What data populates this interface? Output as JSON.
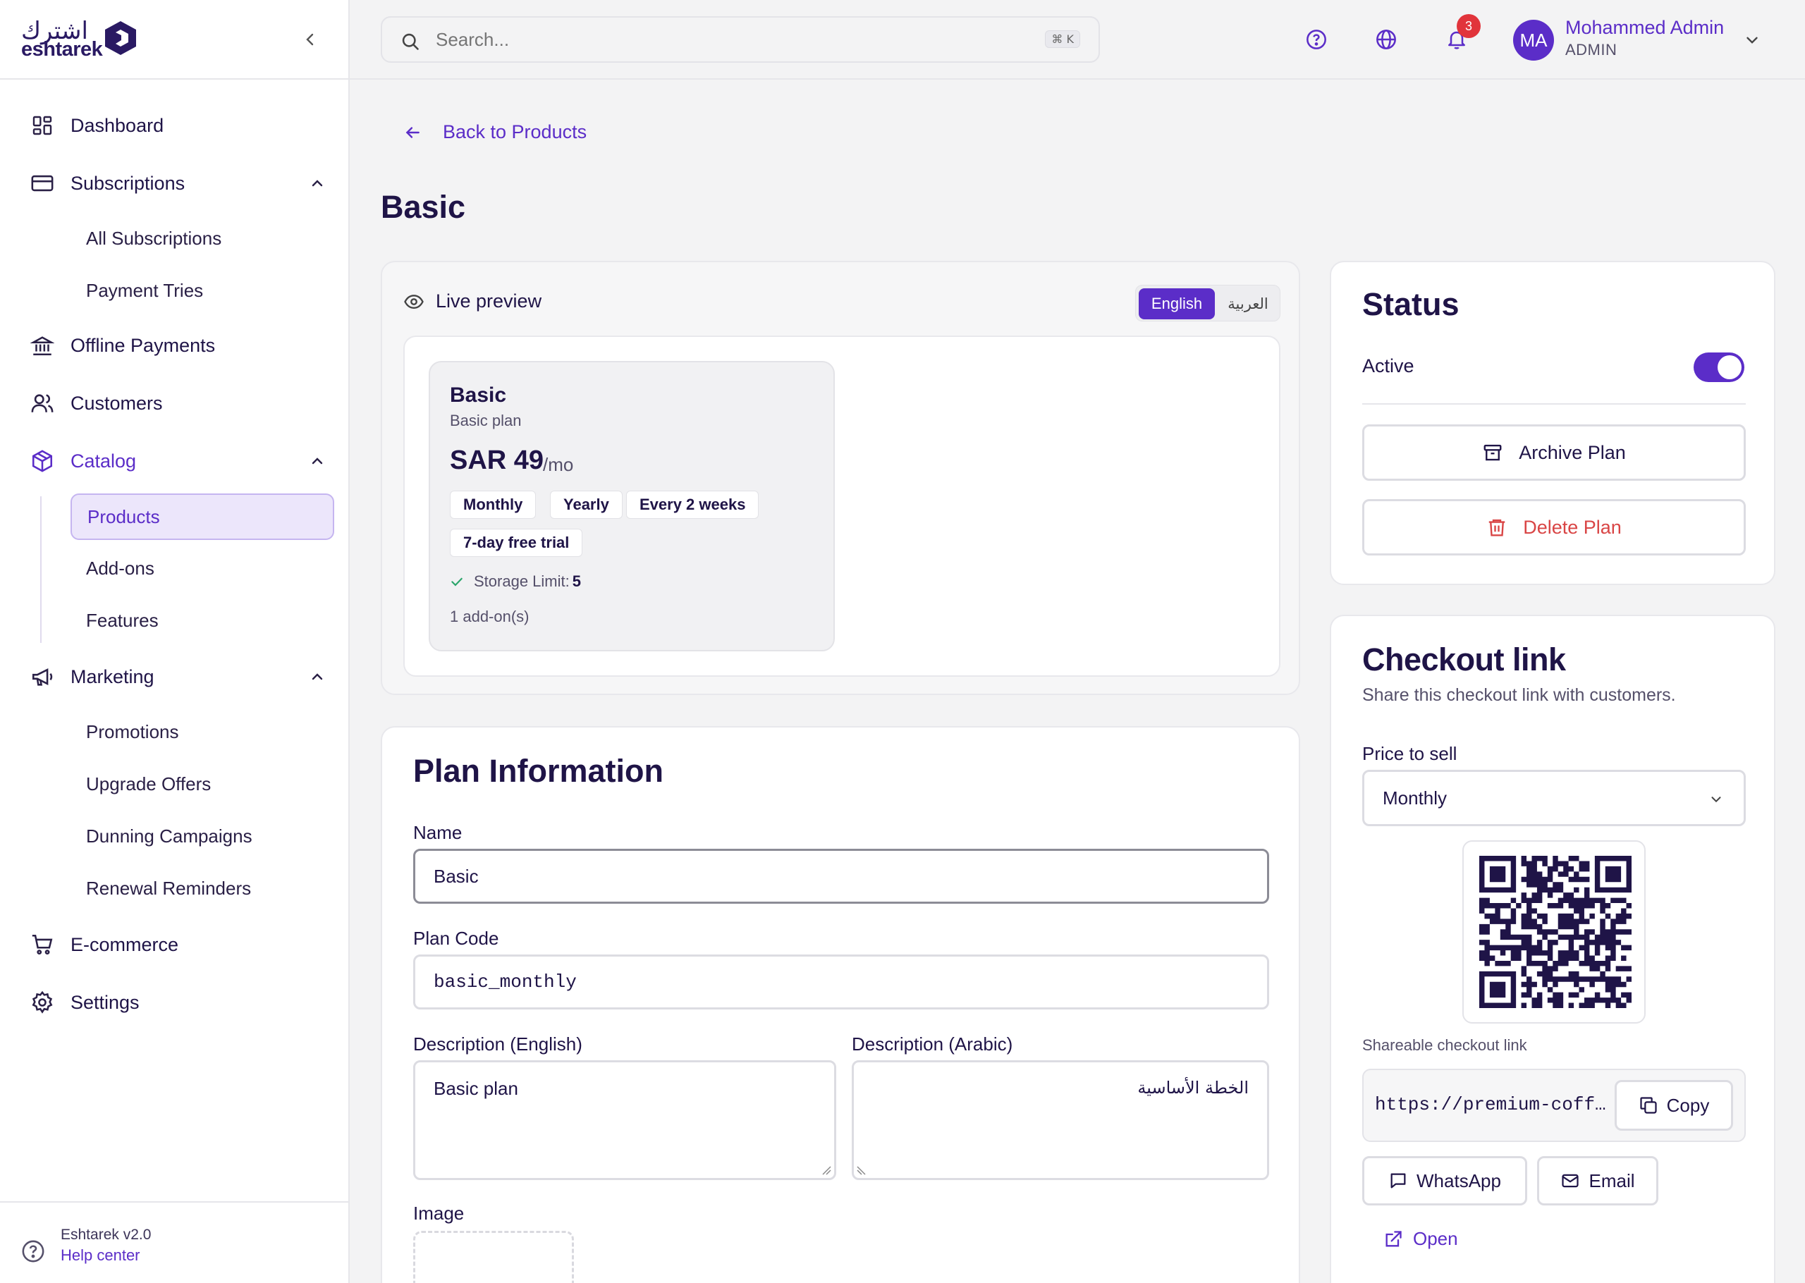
{
  "brand": {
    "arabic": "اشترك",
    "english": "eshtarek"
  },
  "sidebar": {
    "items": [
      {
        "label": "Dashboard"
      },
      {
        "label": "Subscriptions"
      },
      {
        "label": "All Subscriptions"
      },
      {
        "label": "Payment Tries"
      },
      {
        "label": "Offline Payments"
      },
      {
        "label": "Customers"
      },
      {
        "label": "Catalog"
      },
      {
        "label": "Products"
      },
      {
        "label": "Add-ons"
      },
      {
        "label": "Features"
      },
      {
        "label": "Marketing"
      },
      {
        "label": "Promotions"
      },
      {
        "label": "Upgrade Offers"
      },
      {
        "label": "Dunning Campaigns"
      },
      {
        "label": "Renewal Reminders"
      },
      {
        "label": "E-commerce"
      },
      {
        "label": "Settings"
      }
    ],
    "footer": {
      "version": "Eshtarek v2.0",
      "help": "Help center"
    }
  },
  "topbar": {
    "search_placeholder": "Search...",
    "shortcut": "⌘ K",
    "notification_count": "3",
    "user": {
      "initials": "MA",
      "name": "Mohammed Admin",
      "role": "ADMIN"
    }
  },
  "page": {
    "back_label": "Back to Products",
    "title": "Basic"
  },
  "preview": {
    "heading": "Live preview",
    "lang_en": "English",
    "lang_ar": "العربية",
    "plan": {
      "name": "Basic",
      "subtitle": "Basic plan",
      "price": "SAR 49",
      "period": "/mo",
      "chips": [
        "Monthly",
        "Yearly",
        "Every 2 weeks"
      ],
      "trial": "7-day free trial",
      "feature_label": "Storage Limit:",
      "feature_value": "5",
      "addons": "1 add-on(s)"
    }
  },
  "plan_info": {
    "heading": "Plan Information",
    "name_label": "Name",
    "name_value": "Basic",
    "code_label": "Plan Code",
    "code_value": "basic_monthly",
    "desc_en_label": "Description (English)",
    "desc_en_value": "Basic plan",
    "desc_ar_label": "Description (Arabic)",
    "desc_ar_value": "الخطة الأساسية",
    "image_label": "Image"
  },
  "status": {
    "heading": "Status",
    "active_label": "Active",
    "active": true,
    "archive_label": "Archive Plan",
    "delete_label": "Delete Plan"
  },
  "checkout": {
    "heading": "Checkout link",
    "subtitle": "Share this checkout link with customers.",
    "price_label": "Price to sell",
    "price_value": "Monthly",
    "share_label": "Shareable checkout link",
    "url": "https://premium-coff…",
    "copy_label": "Copy",
    "whatsapp_label": "WhatsApp",
    "email_label": "Email",
    "open_label": "Open"
  },
  "colors": {
    "accent": "#5b2dc8",
    "text": "#1f1447",
    "danger": "#d94545",
    "badge": "#e1343b"
  }
}
